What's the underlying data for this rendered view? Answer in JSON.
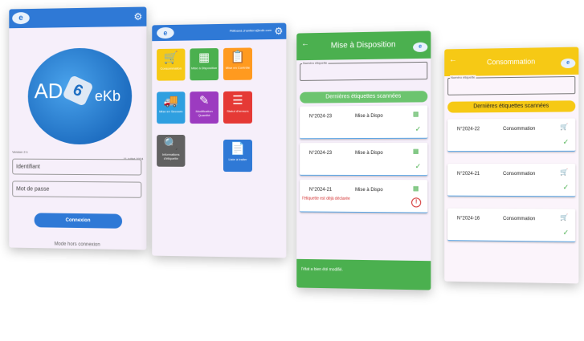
{
  "colors": {
    "blue": "#2f79d6",
    "green": "#4bb04f",
    "yellow": "#f6c915",
    "red": "#d32f2f"
  },
  "login": {
    "version": "Version 2.1",
    "date": "11 juillet 2024",
    "logo_text_left": "AD",
    "logo_mark": "6",
    "logo_text_right": "eKb",
    "username_placeholder": "Identifiant",
    "password_placeholder": "Mot de passe",
    "login_button": "Connexion",
    "offline_link": "Mode hors connexion"
  },
  "menu": {
    "email": "Ptifiband.chantiers@edb.com",
    "tiles": [
      {
        "label": "Consommation",
        "icon": "cart-icon",
        "glyph": "🛒",
        "color": "#f6c915"
      },
      {
        "label": "Mise à Disposition",
        "icon": "shelf-icon",
        "glyph": "▦",
        "color": "#4bb04f"
      },
      {
        "label": "Mise en Contrôle",
        "icon": "clipboard-search-icon",
        "glyph": "📋",
        "color": "#ff9a1f"
      },
      {
        "label": "Mise en Secours",
        "icon": "truck-icon",
        "glyph": "🚚",
        "color": "#2f9fe0"
      },
      {
        "label": "Modification Quantité",
        "icon": "edit-list-icon",
        "glyph": "✎",
        "color": "#9c3bc0"
      },
      {
        "label": "Statut d'erreurs",
        "icon": "error-list-icon",
        "glyph": "☰",
        "color": "#e53935"
      },
      {
        "label": "Informations d'étiquette",
        "icon": "search-icon",
        "glyph": "🔍",
        "color": "#616161"
      },
      {
        "label": "Liste à traiter",
        "icon": "document-list-icon",
        "glyph": "📄",
        "color": "#2f79d6"
      }
    ]
  },
  "disposition": {
    "title": "Mise à Disposition",
    "field_label": "Numéro étiquette",
    "recent_label": "Dernières étiquettes scannées",
    "cards": [
      {
        "number": "N°2024-23",
        "status": "Mise à Dispo",
        "message": ""
      },
      {
        "number": "N°2024-23",
        "status": "Mise à Dispo",
        "message": ""
      },
      {
        "number": "N°2024-21",
        "status": "Mise à Dispo",
        "message": "l'étiquette est déjà déclarée"
      }
    ],
    "toast": "l'état a bien été modifié."
  },
  "consommation": {
    "title": "Consommation",
    "field_label": "Numéro étiquette",
    "recent_label": "Dernières étiquettes scannées",
    "cards": [
      {
        "number": "N°2024-22",
        "status": "Consommation"
      },
      {
        "number": "N°2024-21",
        "status": "Consommation"
      },
      {
        "number": "N°2024-16",
        "status": "Consommation"
      }
    ]
  }
}
